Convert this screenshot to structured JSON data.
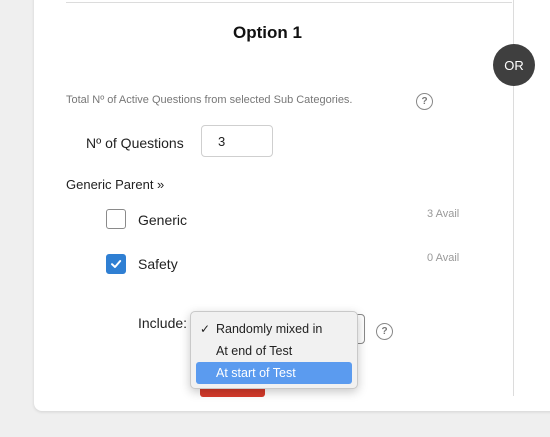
{
  "option": {
    "title": "Option 1",
    "or_label": "OR"
  },
  "total": {
    "text": "Total Nº of Active Questions from selected Sub Categories.",
    "help_glyph": "?"
  },
  "questions": {
    "label": "Nº of Questions",
    "value": "3"
  },
  "generic_parent": {
    "label": "Generic Parent »"
  },
  "categories": [
    {
      "label": "Generic",
      "avail": "3 Avail",
      "checked": false
    },
    {
      "label": "Safety",
      "avail": "0 Avail",
      "checked": true
    }
  ],
  "include": {
    "label": "Include:",
    "help_glyph": "?",
    "selected": "Randomly mixed in",
    "options": [
      "Randomly mixed in",
      "At end of Test",
      "At start of Test"
    ],
    "highlighted": "At start of Test"
  },
  "colors": {
    "accent": "#2f7fd3",
    "highlight": "#5b9bef",
    "or_badge": "#3f3f3f",
    "danger": "#d63a2a"
  }
}
